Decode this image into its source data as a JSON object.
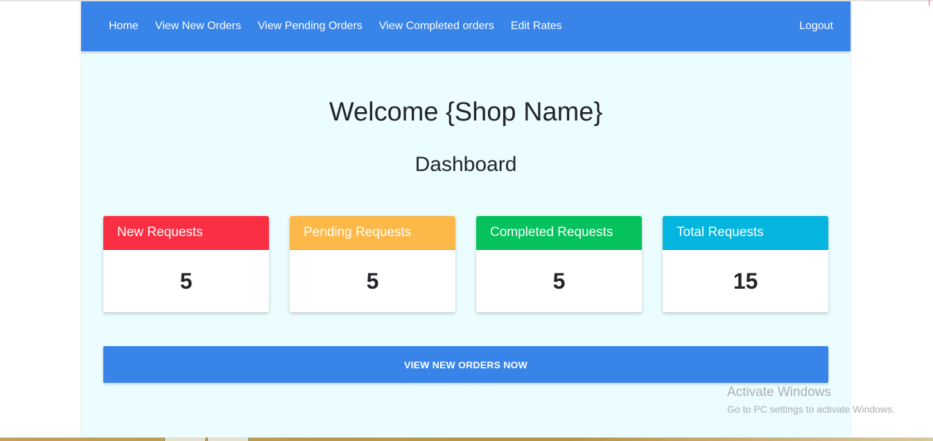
{
  "nav": {
    "items": [
      {
        "label": "Home"
      },
      {
        "label": "View New Orders"
      },
      {
        "label": "View Pending Orders"
      },
      {
        "label": "View Completed orders"
      },
      {
        "label": "Edit Rates"
      }
    ],
    "logout_label": "Logout"
  },
  "main": {
    "welcome_text": "Welcome {Shop Name}",
    "dashboard_title": "Dashboard"
  },
  "cards": [
    {
      "title": "New Requests",
      "value": "5",
      "color": "#fb2f44"
    },
    {
      "title": "Pending Requests",
      "value": "5",
      "color": "#fcb94a"
    },
    {
      "title": "Completed Requests",
      "value": "5",
      "color": "#05c25d"
    },
    {
      "title": "Total Requests",
      "value": "15",
      "color": "#04b5df"
    }
  ],
  "cta": {
    "label": "VIEW NEW ORDERS NOW"
  },
  "watermark": {
    "title": "Activate Windows",
    "subtitle": "Go to PC settings to activate Windows."
  },
  "colors": {
    "primary": "#3884e9",
    "background": "#ebfdfe"
  }
}
